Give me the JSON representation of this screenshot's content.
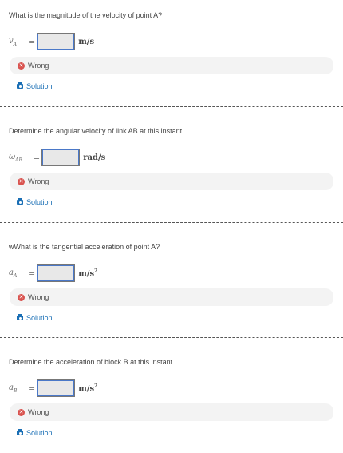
{
  "questions": [
    {
      "text": "What is the magnitude of the velocity of point A?",
      "var_main": "v",
      "var_sub": "A",
      "equals": "=",
      "unit_base": "m/s",
      "unit_exp": "",
      "status": "Wrong",
      "solution": "Solution"
    },
    {
      "text": "Determine the angular velocity of link AB at this instant.",
      "var_main": "ω",
      "var_sub": "AB",
      "equals": "=",
      "unit_base": "rad/s",
      "unit_exp": "",
      "status": "Wrong",
      "solution": "Solution"
    },
    {
      "text": "wWhat is the tangential acceleration of point A?",
      "var_main": "a",
      "var_sub": "A",
      "equals": "=",
      "unit_base": "m/s",
      "unit_exp": "2",
      "status": "Wrong",
      "solution": "Solution"
    },
    {
      "text": "Determine the acceleration of block B at this instant.",
      "var_main": "a",
      "var_sub": "B",
      "equals": "=",
      "unit_base": "m/s",
      "unit_exp": "2",
      "status": "Wrong",
      "solution": "Solution"
    }
  ]
}
